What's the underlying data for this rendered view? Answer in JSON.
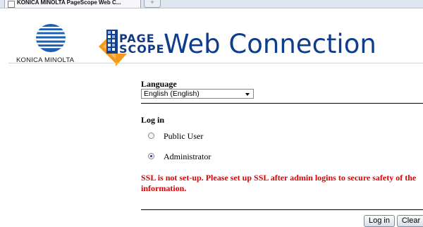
{
  "browser": {
    "tab_title": "KONICA MINOLTA PageScope Web C...",
    "new_tab_symbol": "+"
  },
  "header": {
    "brand_text": "KONICA MINOLTA",
    "product_page": "PAGE",
    "product_scope": "SCOPE",
    "title": "Web Connection",
    "brand_icon": "konica-minolta-globe-icon",
    "product_icon": "pagescope-logo-icon"
  },
  "form": {
    "language_label": "Language",
    "language_selected": "English (English)",
    "login_label": "Log in",
    "options": [
      {
        "label": "Public User",
        "checked": false
      },
      {
        "label": "Administrator",
        "checked": true
      }
    ],
    "ssl_warning": "SSL is not set-up. Please set up SSL after admin logins to secure safety of the information.",
    "login_button": "Log in",
    "clear_button": "Clear"
  },
  "colors": {
    "title_blue": "#0e3d8c",
    "warning_red": "#e00000",
    "logo_orange": "#f39a1c"
  }
}
